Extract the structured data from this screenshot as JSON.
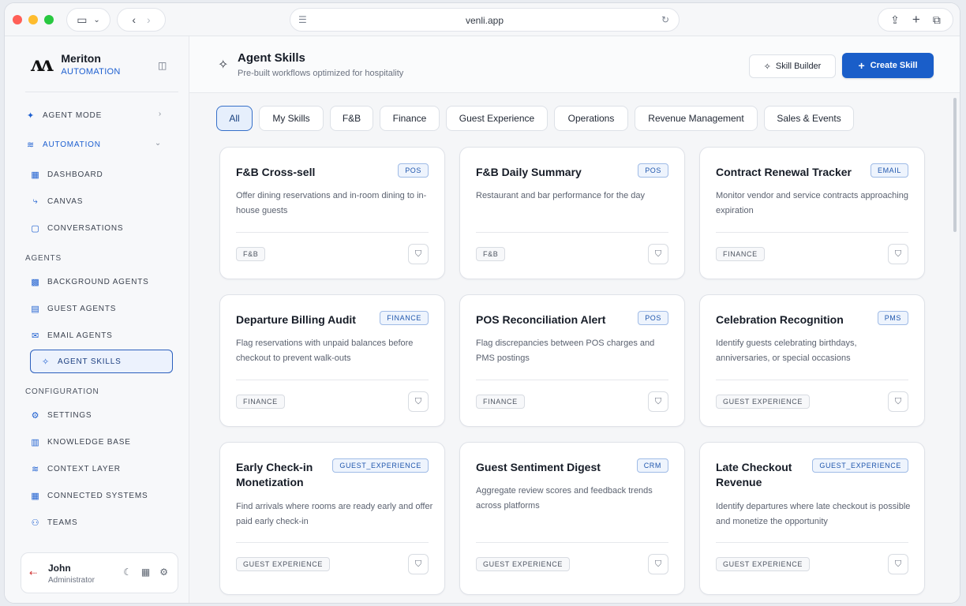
{
  "browser": {
    "url": "venli.app"
  },
  "brand": {
    "name": "Meriton",
    "subtitle": "AUTOMATION"
  },
  "sidebar": {
    "agent_mode": "AGENT MODE",
    "automation": "AUTOMATION",
    "automation_items": [
      "DASHBOARD",
      "CANVAS",
      "CONVERSATIONS"
    ],
    "agents_label": "AGENTS",
    "agents_items": [
      "BACKGROUND AGENTS",
      "GUEST AGENTS",
      "EMAIL AGENTS",
      "AGENT SKILLS"
    ],
    "configuration_label": "CONFIGURATION",
    "configuration_items": [
      "SETTINGS",
      "KNOWLEDGE BASE",
      "CONTEXT LAYER",
      "CONNECTED SYSTEMS",
      "TEAMS"
    ],
    "active_item": "AGENT SKILLS"
  },
  "user": {
    "name": "John",
    "role": "Administrator"
  },
  "header": {
    "title": "Agent Skills",
    "subtitle": "Pre-built workflows optimized for hospitality",
    "skill_builder_label": "Skill Builder",
    "create_skill_label": "Create Skill"
  },
  "filters": [
    "All",
    "My Skills",
    "F&B",
    "Finance",
    "Guest Experience",
    "Operations",
    "Revenue Management",
    "Sales & Events"
  ],
  "active_filter": "All",
  "cards": [
    {
      "title": "F&B Cross-sell",
      "badge": "POS",
      "desc": "Offer dining reservations and in-room dining to in-house guests",
      "tag": "F&B"
    },
    {
      "title": "F&B Daily Summary",
      "badge": "POS",
      "desc": "Restaurant and bar performance for the day",
      "tag": "F&B"
    },
    {
      "title": "Contract Renewal Tracker",
      "badge": "EMAIL",
      "desc": "Monitor vendor and service contracts approaching expiration",
      "tag": "FINANCE"
    },
    {
      "title": "Departure Billing Audit",
      "badge": "FINANCE",
      "desc": "Flag reservations with unpaid balances before checkout to prevent walk-outs",
      "tag": "FINANCE"
    },
    {
      "title": "POS Reconciliation Alert",
      "badge": "POS",
      "desc": "Flag discrepancies between POS charges and PMS postings",
      "tag": "FINANCE"
    },
    {
      "title": "Celebration Recognition",
      "badge": "PMS",
      "desc": "Identify guests celebrating birthdays, anniversaries, or special occasions",
      "tag": "GUEST EXPERIENCE"
    },
    {
      "title": "Early Check-in Monetization",
      "badge": "GUEST_EXPERIENCE",
      "desc": "Find arrivals where rooms are ready early and offer paid early check-in",
      "tag": "GUEST EXPERIENCE"
    },
    {
      "title": "Guest Sentiment Digest",
      "badge": "CRM",
      "desc": "Aggregate review scores and feedback trends across platforms",
      "tag": "GUEST EXPERIENCE"
    },
    {
      "title": "Late Checkout Revenue",
      "badge": "GUEST_EXPERIENCE",
      "desc": "Identify departures where late checkout is possible and monetize the opportunity",
      "tag": "GUEST EXPERIENCE"
    }
  ],
  "colors": {
    "accent": "#1a5ec9",
    "logout": "#d23a3a"
  }
}
